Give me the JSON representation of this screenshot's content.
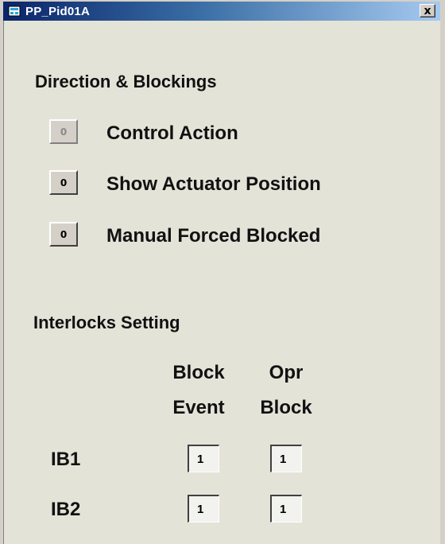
{
  "window": {
    "title": "PP_Pid01A",
    "close_glyph": "x"
  },
  "directions": {
    "heading": "Direction &  Blockings",
    "options": [
      {
        "value": "0",
        "label": "Control Action",
        "enabled": false
      },
      {
        "value": "0",
        "label": "Show Actuator Position",
        "enabled": true
      },
      {
        "value": "0",
        "label": "Manual Forced Blocked",
        "enabled": true
      }
    ]
  },
  "interlocks": {
    "heading": "Interlocks Setting",
    "columns": [
      {
        "line1": "Block",
        "line2": "Event"
      },
      {
        "line1": "Opr",
        "line2": "Block"
      }
    ],
    "rows": [
      {
        "label": "IB1",
        "block_event": "1",
        "opr_block": "1"
      },
      {
        "label": "IB2",
        "block_event": "1",
        "opr_block": "1"
      }
    ]
  },
  "icons": {
    "title_icon": "faceplate-icon",
    "close": "close-icon"
  }
}
